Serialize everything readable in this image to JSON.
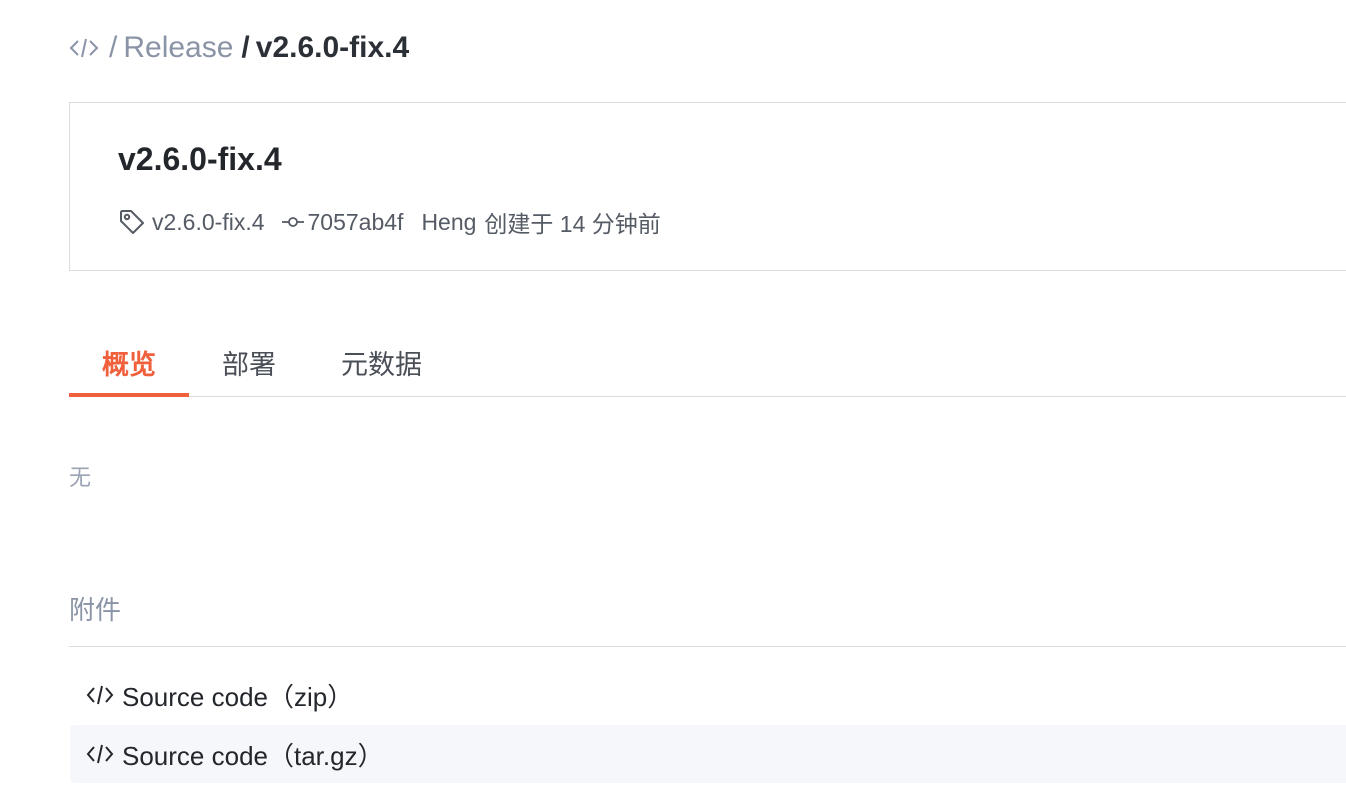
{
  "breadcrumb": {
    "icon": "code-icon",
    "separator": "/",
    "parent": "Release",
    "current": "v2.6.0-fix.4"
  },
  "release": {
    "title": "v2.6.0-fix.4",
    "tag": "v2.6.0-fix.4",
    "commit": "7057ab4f",
    "author": "Heng",
    "created": "创建于 14 分钟前"
  },
  "tabs": [
    {
      "label": "概览",
      "active": true
    },
    {
      "label": "部署",
      "active": false
    },
    {
      "label": "元数据",
      "active": false
    }
  ],
  "overview": {
    "empty_text": "无"
  },
  "attachments": {
    "title": "附件",
    "items": [
      {
        "label": "Source code（zip）",
        "icon": "code-icon"
      },
      {
        "label": "Source code（tar.gz）",
        "icon": "code-icon"
      }
    ]
  },
  "colors": {
    "accent": "#f0603d",
    "muted": "#8a94a6",
    "border": "#d9dce1"
  }
}
